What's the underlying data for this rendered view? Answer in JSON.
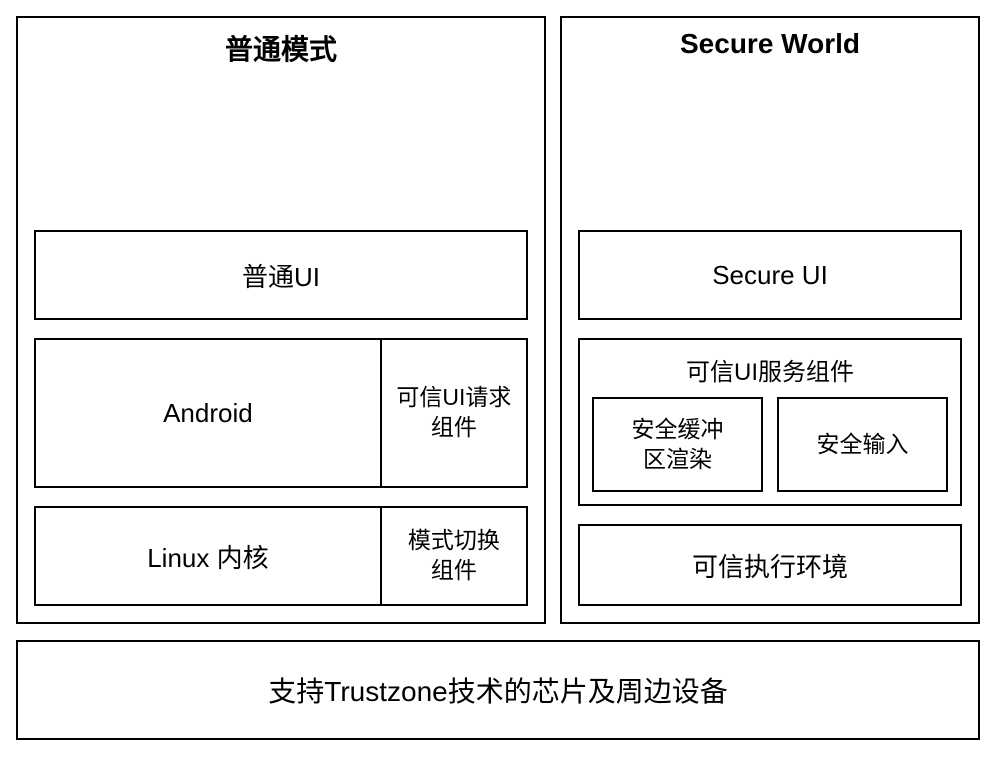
{
  "normal_world": {
    "title": "普通模式",
    "ui_label": "普通UI",
    "android_label": "Android",
    "trusted_ui_request_label": "可信UI请求\n组件",
    "linux_kernel_label": "Linux 内核",
    "mode_switch_label": "模式切换\n组件"
  },
  "secure_world": {
    "title": "Secure World",
    "ui_label": "Secure UI",
    "trusted_ui_service_title": "可信UI服务组件",
    "secure_buffer_render_label": "安全缓冲\n区渲染",
    "secure_input_label": "安全输入",
    "tee_label": "可信执行环境"
  },
  "hardware_label": "支持Trustzone技术的芯片及周边设备"
}
